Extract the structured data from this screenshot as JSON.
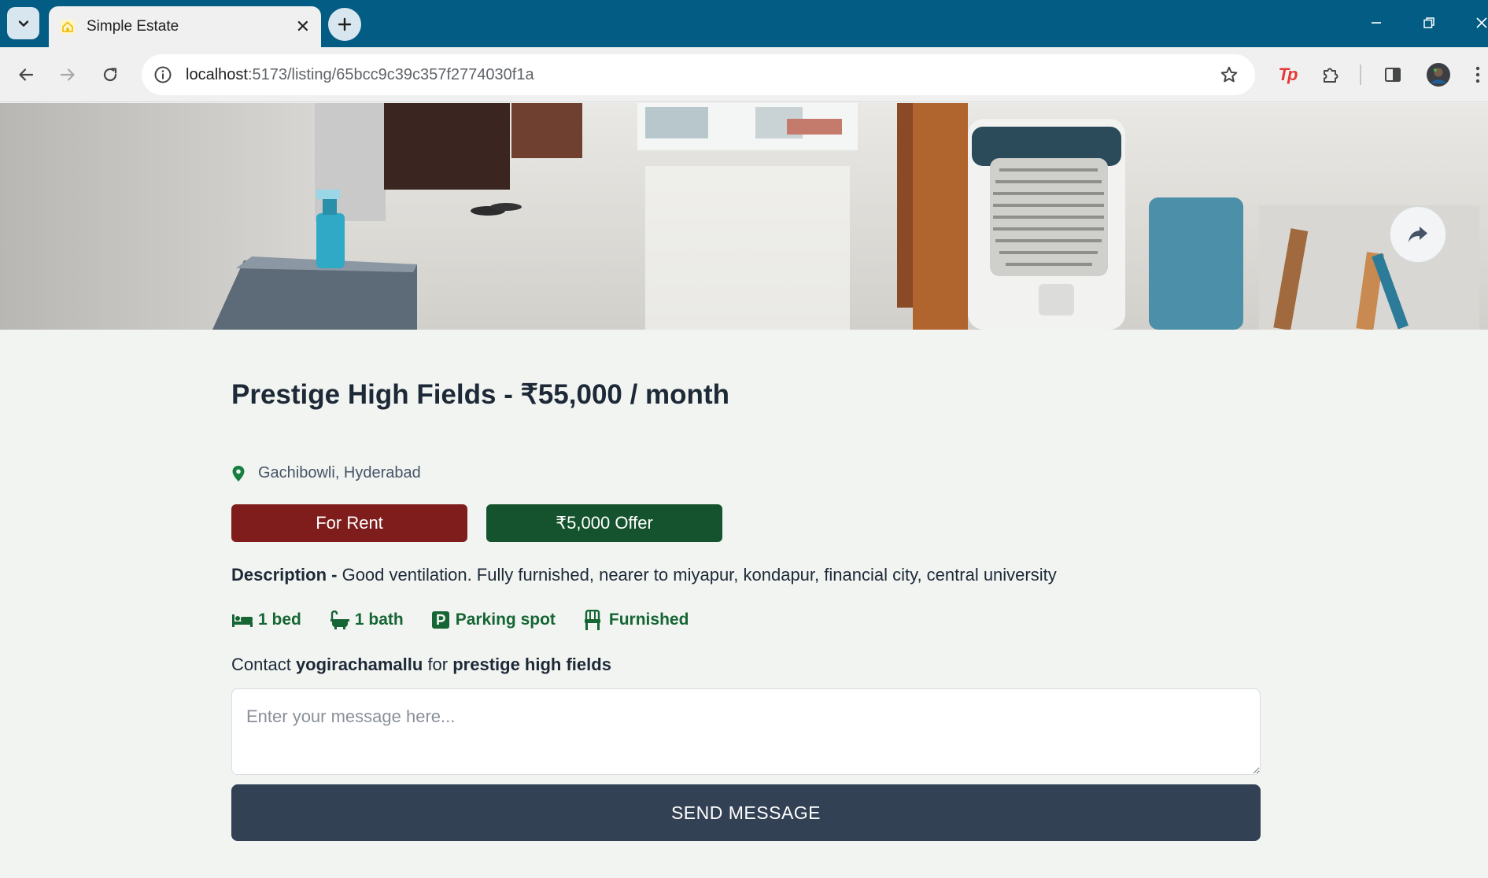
{
  "browser": {
    "tab": {
      "title": "Simple Estate",
      "close_glyph": "✕"
    },
    "url": {
      "host": "localhost",
      "path": ":5173/listing/65bcc9c39c357f2774030f1a"
    },
    "new_tab_glyph": "+",
    "extensions": [
      {
        "name": "tp-extension-icon",
        "text": "Tp",
        "color": "#e53935"
      },
      {
        "name": "extensions-puzzle-icon"
      },
      {
        "name": "side-panel-icon"
      },
      {
        "name": "profile-avatar"
      }
    ]
  },
  "listing": {
    "title": "Prestige High Fields - ₹55,000 / month",
    "address": "Gachibowli, Hyderabad",
    "type_badge": "For Rent",
    "offer_badge": "₹5,000 Offer",
    "description_label": "Description - ",
    "description": "Good ventilation. Fully furnished, nearer to miyapur, kondapur, financial city, central university",
    "features": {
      "beds": "1 bed",
      "baths": "1 bath",
      "parking": "Parking spot",
      "furnished": "Furnished"
    },
    "contact": {
      "prefix": "Contact ",
      "owner": "yogirachamallu",
      "middle": " for ",
      "listing_name": "prestige high fields"
    },
    "message_placeholder": "Enter your message here...",
    "send_label": "SEND MESSAGE"
  },
  "colors": {
    "titlebar": "#035c84",
    "rent_badge": "#7f1d1d",
    "offer_badge": "#14532d",
    "feature_text": "#166534",
    "send_button": "#334155",
    "page_bg": "#f1f4f1"
  }
}
